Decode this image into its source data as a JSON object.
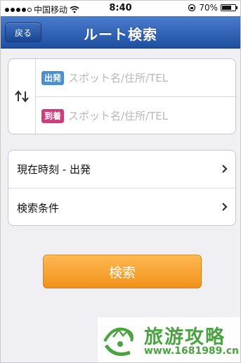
{
  "status_bar": {
    "carrier": "中国移动",
    "time": "8:40",
    "battery": "70%",
    "battery_level": 0.7
  },
  "nav": {
    "back_label": "戻る",
    "title": "ルート検索"
  },
  "route": {
    "departure_tag": "出発",
    "departure_placeholder": "スポット名/住所/TEL",
    "arrival_tag": "到着",
    "arrival_placeholder": "スポット名/住所/TEL"
  },
  "options": {
    "time_label": "現在時刻 - 出発",
    "conditions_label": "検索条件"
  },
  "search_button_label": "検索",
  "watermark": {
    "title": "旅游攻略",
    "url": "www.1681989.cn"
  },
  "colors": {
    "nav_bar": "#2c5fb2",
    "departure_tag": "#4b8fd0",
    "arrival_tag": "#cc3d7a",
    "search_button": "#f5a030",
    "watermark": "#4aa340"
  },
  "icons": [
    "signal-icon",
    "wifi-icon",
    "rotation-lock-icon",
    "battery-icon",
    "swap-icon",
    "chevron-right-icon"
  ]
}
